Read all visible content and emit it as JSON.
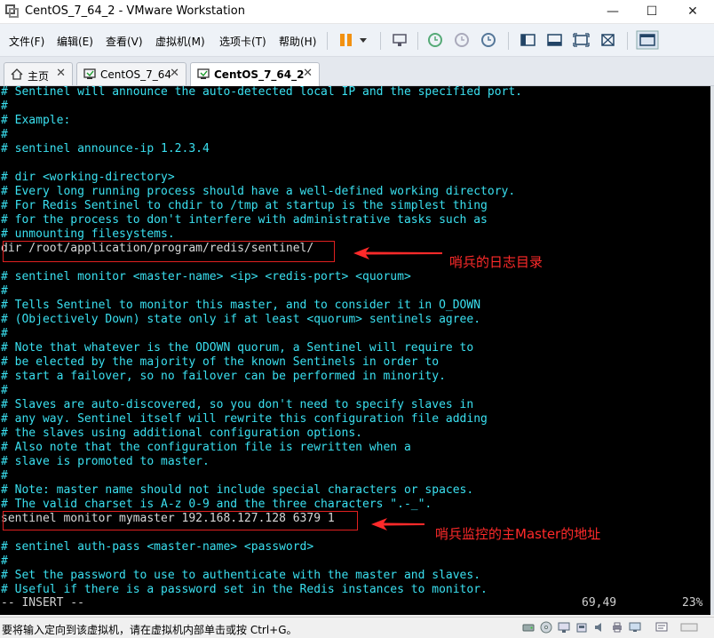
{
  "window": {
    "title": "CentOS_7_64_2 - VMware Workstation"
  },
  "menu": [
    "文件(F)",
    "编辑(E)",
    "查看(V)",
    "虚拟机(M)",
    "选项卡(T)",
    "帮助(H)"
  ],
  "tabs": [
    {
      "label": "主页"
    },
    {
      "label": "CentOS_7_64"
    },
    {
      "label": "CentOS_7_64_2"
    }
  ],
  "terminal": {
    "lines": [
      "# Sentinel will announce the auto-detected local IP and the specified port.",
      "#",
      "# Example:",
      "#",
      "# sentinel announce-ip 1.2.3.4",
      "",
      "# dir <working-directory>",
      "# Every long running process should have a well-defined working directory.",
      "# For Redis Sentinel to chdir to /tmp at startup is the simplest thing",
      "# for the process to don't interfere with administrative tasks such as",
      "# unmounting filesystems.",
      "dir /root/application/program/redis/sentinel/",
      "",
      "# sentinel monitor <master-name> <ip> <redis-port> <quorum>",
      "#",
      "# Tells Sentinel to monitor this master, and to consider it in O_DOWN",
      "# (Objectively Down) state only if at least <quorum> sentinels agree.",
      "#",
      "# Note that whatever is the ODOWN quorum, a Sentinel will require to",
      "# be elected by the majority of the known Sentinels in order to",
      "# start a failover, so no failover can be performed in minority.",
      "#",
      "# Slaves are auto-discovered, so you don't need to specify slaves in",
      "# any way. Sentinel itself will rewrite this configuration file adding",
      "# the slaves using additional configuration options.",
      "# Also note that the configuration file is rewritten when a",
      "# slave is promoted to master.",
      "#",
      "# Note: master name should not include special characters or spaces.",
      "# The valid charset is A-z 0-9 and the three characters \".-_\".",
      "sentinel monitor mymaster 192.168.127.128 6379 1",
      "",
      "# sentinel auth-pass <master-name> <password>",
      "#",
      "# Set the password to use to authenticate with the master and slaves.",
      "# Useful if there is a password set in the Redis instances to monitor."
    ],
    "mode": "-- INSERT --",
    "position": "69,49",
    "percent": "23%"
  },
  "annotations": {
    "dir": "哨兵的日志目录",
    "monitor": "哨兵监控的主Master的地址"
  },
  "statusbar": {
    "message": "要将输入定向到该虚拟机，请在虚拟机内部单击或按 Ctrl+G。"
  },
  "colors": {
    "terminal_text": "#3ae0f0",
    "annotation": "#ff2a2a"
  }
}
